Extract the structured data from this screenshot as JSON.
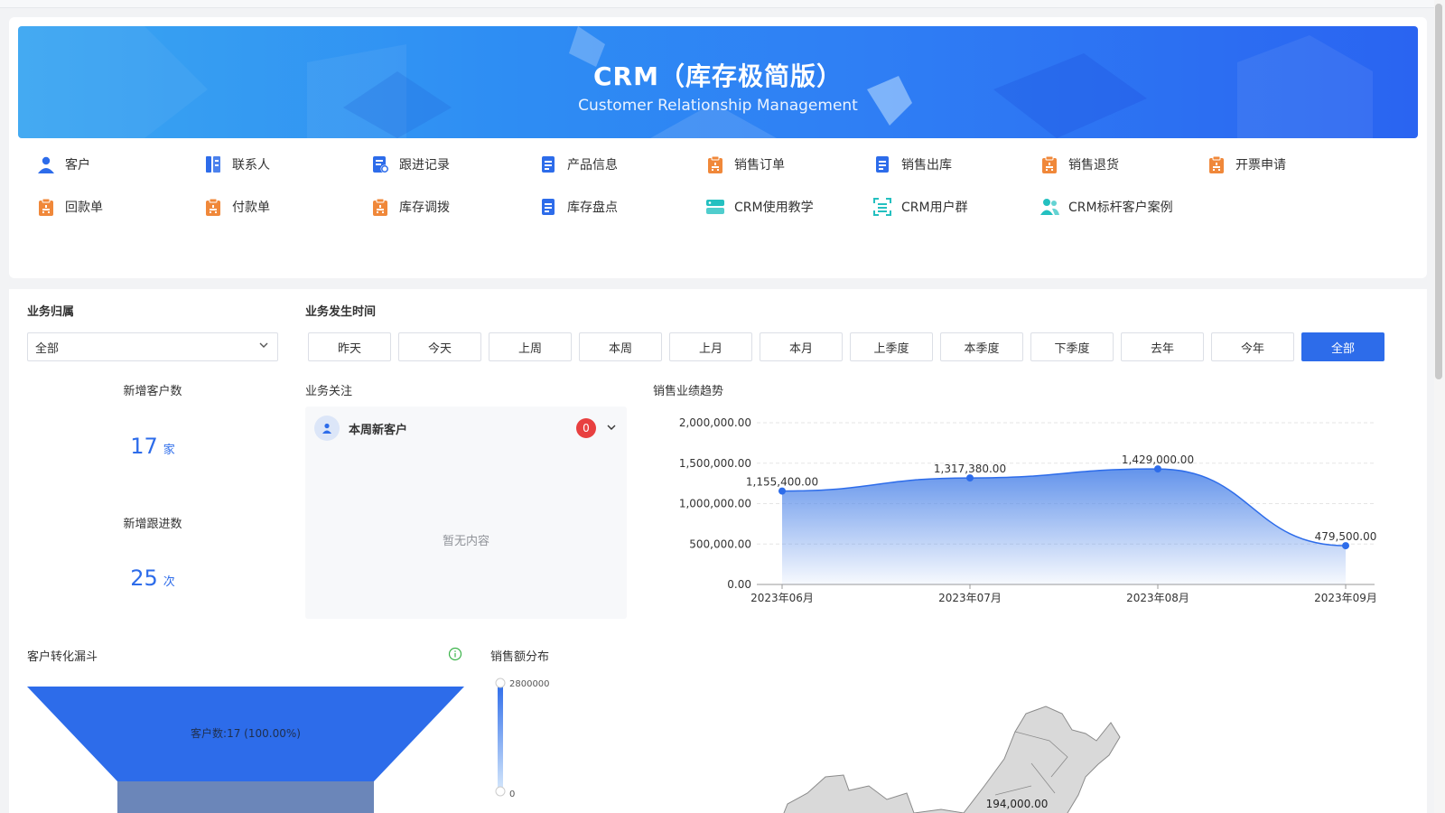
{
  "banner": {
    "title": "CRM（库存极简版）",
    "subtitle": "Customer Relationship Management"
  },
  "quick_links": [
    {
      "label": "客户",
      "icon": "customer-icon",
      "color": "#2d6cea"
    },
    {
      "label": "联系人",
      "icon": "contact-icon",
      "color": "#2d6cea"
    },
    {
      "label": "跟进记录",
      "icon": "follow-record-icon",
      "color": "#2d6cea"
    },
    {
      "label": "产品信息",
      "icon": "product-doc-icon",
      "color": "#2d6cea"
    },
    {
      "label": "销售订单",
      "icon": "clipboard-icon",
      "color": "#f0883a"
    },
    {
      "label": "销售出库",
      "icon": "document-icon",
      "color": "#2d6cea"
    },
    {
      "label": "销售退货",
      "icon": "clipboard-icon",
      "color": "#f0883a"
    },
    {
      "label": "开票申请",
      "icon": "clipboard-icon",
      "color": "#f0883a"
    },
    {
      "label": "回款单",
      "icon": "clipboard-icon",
      "color": "#f0883a"
    },
    {
      "label": "付款单",
      "icon": "clipboard-icon",
      "color": "#f0883a"
    },
    {
      "label": "库存调拨",
      "icon": "clipboard-icon",
      "color": "#f0883a"
    },
    {
      "label": "库存盘点",
      "icon": "document-icon",
      "color": "#2d6cea"
    },
    {
      "label": "CRM使用教学",
      "icon": "tutorial-icon",
      "color": "#24c0c0"
    },
    {
      "label": "CRM用户群",
      "icon": "scan-group-icon",
      "color": "#24c0c0"
    },
    {
      "label": "CRM标杆客户案例",
      "icon": "users-icon",
      "color": "#24c0c0"
    }
  ],
  "filters": {
    "owner_label": "业务归属",
    "owner_value": "全部",
    "time_label": "业务发生时间",
    "time_buttons": [
      "昨天",
      "今天",
      "上周",
      "本周",
      "上月",
      "本月",
      "上季度",
      "本季度",
      "下季度",
      "去年",
      "今年",
      "全部"
    ],
    "active_time": "全部"
  },
  "kpis": {
    "new_customers_label": "新增客户数",
    "new_customers_value": "17",
    "new_customers_unit": "家",
    "new_followups_label": "新增跟进数",
    "new_followups_value": "25",
    "new_followups_unit": "次"
  },
  "focus": {
    "section_label": "业务关注",
    "item_title": "本周新客户",
    "badge": "0",
    "empty_text": "暂无内容"
  },
  "trend": {
    "section_label": "销售业绩趋势"
  },
  "funnel": {
    "section_label": "客户转化漏斗",
    "top_label": "客户数:17 (100.00%)"
  },
  "distribution": {
    "section_label": "销售额分布",
    "scale_max": "2800000",
    "scale_min": "0",
    "map_label": "194,000.00"
  },
  "chart_data": {
    "type": "area",
    "title": "销售业绩趋势",
    "x": [
      "2023年06月",
      "2023年07月",
      "2023年08月",
      "2023年09月"
    ],
    "series": [
      {
        "values": [
          1155400.0,
          1317380.0,
          1429000.0,
          479500.0
        ],
        "labels": [
          "1,155,400.00",
          "1,317,380.00",
          "1,429,000.00",
          "479,500.00"
        ]
      }
    ],
    "yticks": [
      "0.00",
      "500,000.00",
      "1,000,000.00",
      "1,500,000.00",
      "2,000,000.00"
    ],
    "ylim": [
      0,
      2000000
    ],
    "grid": true,
    "color": "#2d6cea"
  }
}
